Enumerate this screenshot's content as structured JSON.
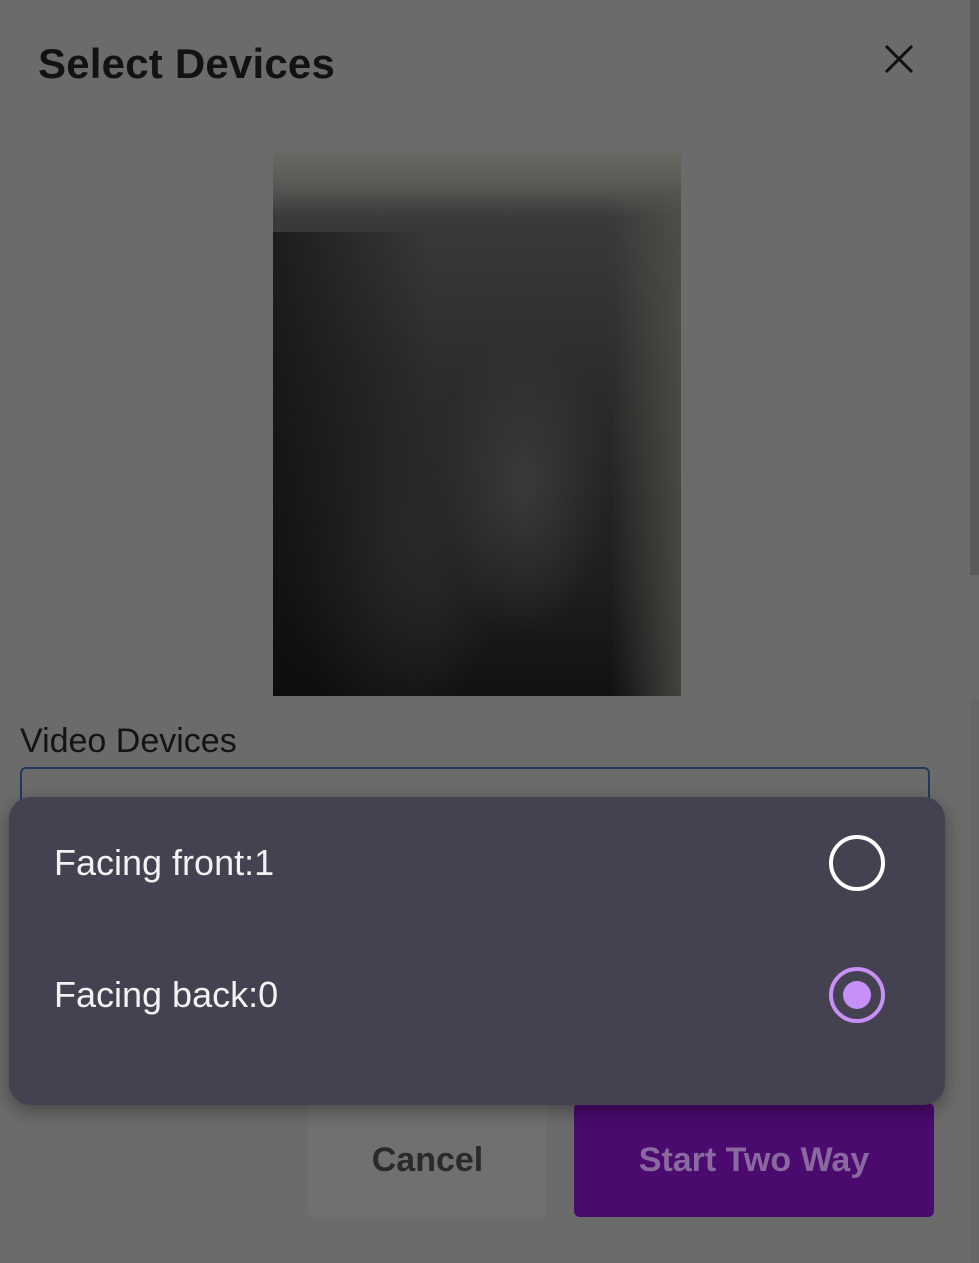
{
  "dialog": {
    "title": "Select Devices",
    "close_icon": "close-icon"
  },
  "video_devices": {
    "label": "Video Devices"
  },
  "device_picker": {
    "options": [
      {
        "label": "Facing front:1",
        "selected": false
      },
      {
        "label": "Facing back:0",
        "selected": true
      }
    ],
    "accent_color": "#c690f7"
  },
  "actions": {
    "cancel_label": "Cancel",
    "start_label": "Start Two Way"
  },
  "colors": {
    "overlay": "#6b6b6b",
    "popup_background": "#444251",
    "primary_button": "#4a0a6e"
  }
}
